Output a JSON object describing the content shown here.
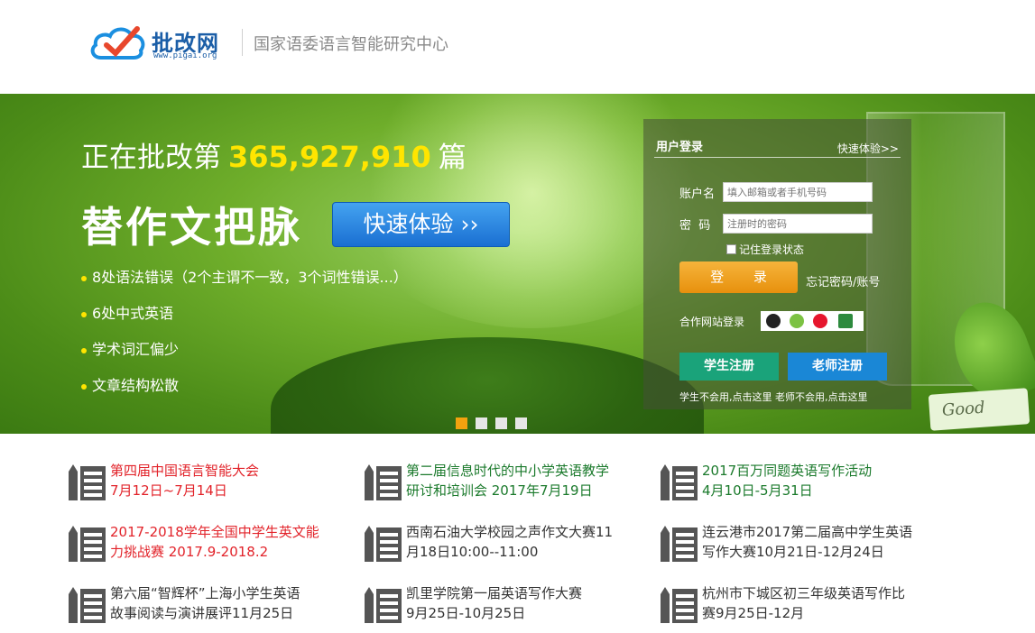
{
  "header": {
    "brand": "批改网",
    "url": "www.pigai.org",
    "org": "国家语委语言智能研究中心"
  },
  "banner": {
    "counter_prefix": "正在批改第",
    "counter_number": "365,927,910",
    "counter_suffix": "篇",
    "slogan": "替作文把脉",
    "try_button": "快速体验 ››",
    "bullets": [
      "8处语法错误（2个主谓不一致，3个词性错误...）",
      "6处中式英语",
      "学术词汇偏少",
      "文章结构松散"
    ],
    "card_text": "Good",
    "active_slide": 1,
    "slide_count": 4
  },
  "login": {
    "title": "用户登录",
    "quick_link": "快速体验>>",
    "username_label": "账户名",
    "username_placeholder": "填入邮箱或者手机号码",
    "password_label": "密  码",
    "password_placeholder": "注册时的密码",
    "remember_label": "记住登录状态",
    "login_button": "登 录",
    "forgot_link": "忘记密码/账号",
    "partner_label": "合作网站登录",
    "student_register": "学生注册",
    "teacher_register": "老师注册",
    "tips": "学生不会用,点击这里  老师不会用,点击这里"
  },
  "news": [
    {
      "title": "第四届中国语言智能大会",
      "date": "7月12日~7月14日",
      "color": "red"
    },
    {
      "title": "第二届信息时代的中小学英语教学",
      "date": "研讨和培训会 2017年7月19日",
      "color": "green"
    },
    {
      "title": "2017百万同题英语写作活动",
      "date": "4月10日-5月31日",
      "color": "green"
    },
    {
      "title": "2017-2018学年全国中学生英文能",
      "date": "力挑战赛 2017.9-2018.2",
      "color": "red"
    },
    {
      "title": "西南石油大学校园之声作文大赛11",
      "date": "月18日10:00--11:00",
      "color": "dark"
    },
    {
      "title": "连云港市2017第二届高中学生英语",
      "date": "写作大赛10月21日-12月24日",
      "color": "dark"
    },
    {
      "title": "第六届“智辉杯”上海小学生英语",
      "date": "故事阅读与演讲展评11月25日",
      "color": "dark"
    },
    {
      "title": "凯里学院第一届英语写作大赛",
      "date": "9月25日-10月25日",
      "color": "dark"
    },
    {
      "title": "杭州市下城区初三年级英语写作比",
      "date": "赛9月25日-12月",
      "color": "dark"
    }
  ],
  "colors": {
    "accent_yellow": "#ffe500",
    "brand_blue": "#1b5ea7",
    "login_orange": "#e7900d",
    "student_green": "#1aa37a",
    "teacher_blue": "#1a87d6"
  },
  "icons": [
    "cloud-check-logo-icon",
    "qq-icon",
    "wechat-icon",
    "weibo-icon",
    "partner-icon",
    "pencil-list-icon"
  ]
}
